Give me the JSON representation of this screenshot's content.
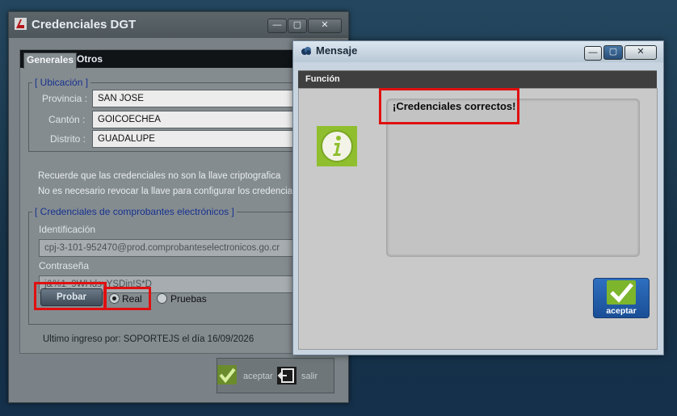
{
  "background_window": {
    "title": "Credenciales DGT",
    "tabs": [
      {
        "label": "Generales",
        "active": true
      },
      {
        "label": "Otros",
        "active": false
      }
    ],
    "ubicacion": {
      "legend": "[ Ubicación ]",
      "provincia": {
        "label": "Provincia :",
        "value": "SAN JOSE"
      },
      "canton": {
        "label": "Cantón :",
        "value": "GOICOECHEA"
      },
      "distrito": {
        "label": "Distrito :",
        "value": "GUADALUPE"
      }
    },
    "notes": [
      "Recuerde que las credenciales no son la llave criptografica",
      "No es necesario revocar la llave para configurar los credenciales"
    ],
    "credenciales": {
      "legend": "[ Credenciales de comprobantes electrónicos ]",
      "identificacion": {
        "label": "Identificación",
        "value": "cpj-3-101-952470@prod.comprobanteselectronicos.go.cr"
      },
      "contrasena": {
        "label": "Contraseña",
        "value": "j&%1_9WHdsvYSDin!S*D"
      }
    },
    "probar_label": "Probar",
    "environment": {
      "options": [
        "Real",
        "Pruebas"
      ],
      "selected": "Real"
    },
    "last_login": "Ultimo ingreso por: SOPORTEJS el día 16/09/2026",
    "footer": {
      "accept_label": "aceptar",
      "exit_label": "salir"
    }
  },
  "dialog": {
    "title": "Mensaje",
    "section_label": "Función",
    "message": "¡Credenciales correctos!",
    "accept_label": "aceptar"
  },
  "colors": {
    "highlight": "#e01010",
    "desktop": "#1b3a52",
    "accept_blue": "#2e6fc0",
    "check_green": "#7db52d"
  }
}
